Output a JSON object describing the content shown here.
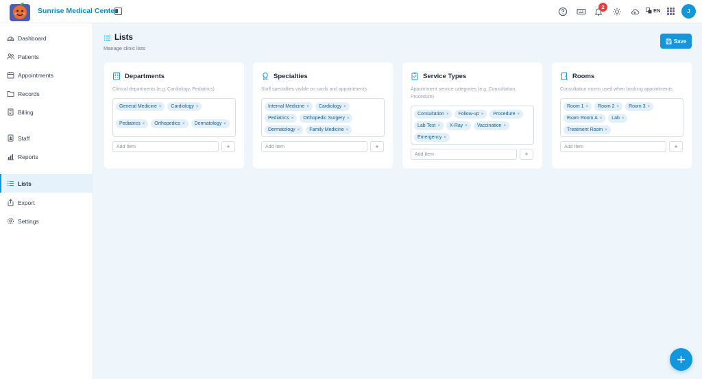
{
  "app": {
    "name": "Sunrise Medical Center"
  },
  "header": {
    "notification_count": "2",
    "language": "EN",
    "user_initial": "J",
    "icons": [
      "help-icon",
      "keyboard-icon",
      "bell-icon",
      "sun-icon",
      "cloud-icon",
      "translate-icon",
      "apps-grid-icon"
    ]
  },
  "sidebar": {
    "items": [
      {
        "label": "Dashboard",
        "icon": "dashboard-icon"
      },
      {
        "label": "Patients",
        "icon": "users-icon"
      },
      {
        "label": "Appointments",
        "icon": "calendar-icon"
      },
      {
        "label": "Records",
        "icon": "folder-icon"
      },
      {
        "label": "Billing",
        "icon": "receipt-icon"
      },
      {
        "label": "Staff",
        "icon": "badge-icon"
      },
      {
        "label": "Reports",
        "icon": "chart-icon"
      },
      {
        "label": "Lists",
        "icon": "list-icon",
        "active": true
      },
      {
        "label": "Export",
        "icon": "export-icon"
      },
      {
        "label": "Settings",
        "icon": "gear-icon"
      }
    ]
  },
  "page": {
    "title": "Lists",
    "subtitle": "Manage clinic lists",
    "save_label": "Save"
  },
  "cards": [
    {
      "title": "Departments",
      "icon": "building-icon",
      "description": "Clinical departments (e.g. Cardiology, Pediatrics)",
      "items": [
        "General Medicine",
        "Cardiology",
        "Pediatrics",
        "Orthopedics",
        "Dermatology"
      ],
      "add_placeholder": "Add Item"
    },
    {
      "title": "Specialties",
      "icon": "award-icon",
      "description": "Staff specialties visible on cards and appointments",
      "items": [
        "Internal Medicine",
        "Cardiology",
        "Pediatrics",
        "Orthopedic Surgery",
        "Dermatology",
        "Family Medicine"
      ],
      "add_placeholder": "Add Item"
    },
    {
      "title": "Service Types",
      "icon": "clipboard-icon",
      "description": "Appointment service categories (e.g. Consultation, Procedure)",
      "items": [
        "Consultation",
        "Follow-up",
        "Procedure",
        "Lab Test",
        "X-Ray",
        "Vaccination",
        "Emergency"
      ],
      "add_placeholder": "Add Item"
    },
    {
      "title": "Rooms",
      "icon": "door-icon",
      "description": "Consultation rooms used when booking appointments",
      "items": [
        "Room 1",
        "Room 2",
        "Room 3",
        "Exam Room A",
        "Lab",
        "Treatment Room"
      ],
      "add_placeholder": "Add Item"
    }
  ],
  "colors": {
    "accent": "#1496dc",
    "badge": "#ef3b3b",
    "tag_bg": "#e2f0fa",
    "brand_text": "#0e88c7"
  }
}
